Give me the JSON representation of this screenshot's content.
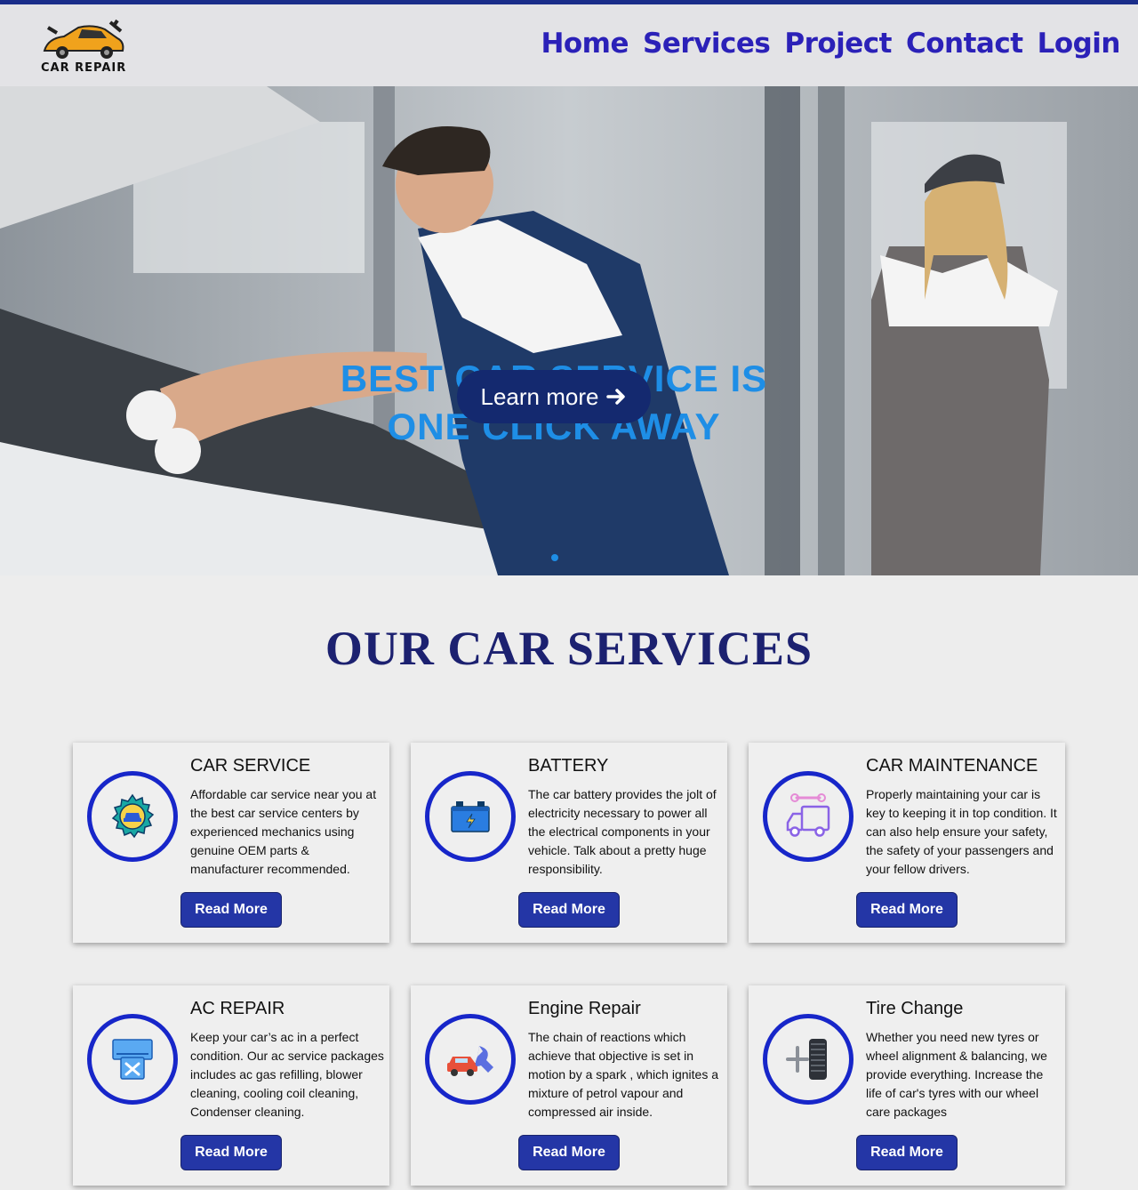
{
  "nav": {
    "logo_text": "CAR REPAIR",
    "items": [
      "Home",
      "Services",
      "Project",
      "Contact",
      "Login"
    ]
  },
  "hero": {
    "title_line1": "BEST CAR SERVICE IS",
    "title_line2": "ONE CLICK AWAY",
    "button_label": "Learn more"
  },
  "services": {
    "heading": "OUR CAR SERVICES",
    "read_more": "Read More",
    "cards": [
      {
        "title": "CAR SERVICE",
        "text": "Affordable car service near you at the best car service centers by experienced mechanics using genuine OEM parts & manufacturer recommended.",
        "icon": "gear-car-icon"
      },
      {
        "title": "BATTERY",
        "text": "The car battery provides the jolt of electricity necessary to power all the electrical components in your vehicle. Talk about a pretty huge responsibility.",
        "icon": "battery-icon"
      },
      {
        "title": "CAR MAINTENANCE",
        "text": "Properly maintaining your car is key to keeping it in top condition. It can also help ensure your safety, the safety of your passengers and your fellow drivers.",
        "icon": "truck-wrench-icon"
      },
      {
        "title": "AC REPAIR",
        "text": "Keep your car’s ac in a perfect condition. Our ac service packages includes ac gas refilling, blower cleaning, cooling coil cleaning, Condenser cleaning.",
        "icon": "ac-unit-icon"
      },
      {
        "title": "Engine Repair",
        "text": "The chain of reactions which achieve that objective is set in motion by a spark , which ignites a mixture of petrol vapour and compressed air inside.",
        "icon": "car-wrench-icon"
      },
      {
        "title": "Tire Change",
        "text": "Whether you need new tyres or wheel alignment & balancing, we provide everything. Increase the life of car's tyres with our wheel care packages",
        "icon": "tire-icon"
      }
    ]
  },
  "colors": {
    "accent": "#1726c9",
    "nav_text": "#2b21b8",
    "button": "#2436a6",
    "hero_title": "#1e8ee6"
  }
}
